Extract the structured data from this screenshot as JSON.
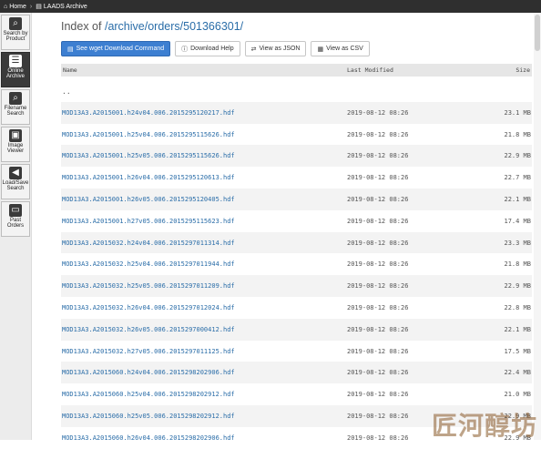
{
  "topbar": {
    "home_label": "Home",
    "archive_label": "LAADS Archive"
  },
  "sidebar": {
    "items": [
      {
        "label1": "Search by",
        "label2": "Product",
        "icon": "search-icon",
        "glyph": "🔍"
      },
      {
        "label1": "Online",
        "label2": "Archive",
        "icon": "list-icon",
        "glyph": "☰"
      },
      {
        "label1": "Filename",
        "label2": "Search",
        "icon": "magnifier-icon",
        "glyph": "🔍"
      },
      {
        "label1": "Image",
        "label2": "Viewer",
        "icon": "image-icon",
        "glyph": "▣"
      },
      {
        "label1": "Load/Save",
        "label2": "Search",
        "icon": "back-arrow-icon",
        "glyph": "◀"
      },
      {
        "label1": "Past",
        "label2": "Orders",
        "icon": "folder-icon",
        "glyph": "▭"
      }
    ]
  },
  "page": {
    "title_prefix": "Index of",
    "title_path": "/archive/orders/501366301/"
  },
  "toolbar": {
    "wget_label": "See wget Download Command",
    "help_label": "Download Help",
    "json_label": "View as JSON",
    "csv_label": "View as CSV"
  },
  "table": {
    "headers": {
      "name": "Name",
      "modified": "Last Modified",
      "size": "Size"
    },
    "parent_label": "..",
    "rows": [
      {
        "name": "MOD13A3.A2015001.h24v04.006.2015295120217.hdf",
        "modified": "2019-08-12 08:26",
        "size": "23.1 MB"
      },
      {
        "name": "MOD13A3.A2015001.h25v04.006.2015295115626.hdf",
        "modified": "2019-08-12 08:26",
        "size": "21.8 MB"
      },
      {
        "name": "MOD13A3.A2015001.h25v05.006.2015295115626.hdf",
        "modified": "2019-08-12 08:26",
        "size": "22.9 MB"
      },
      {
        "name": "MOD13A3.A2015001.h26v04.006.2015295120613.hdf",
        "modified": "2019-08-12 08:26",
        "size": "22.7 MB"
      },
      {
        "name": "MOD13A3.A2015001.h26v05.006.2015295120405.hdf",
        "modified": "2019-08-12 08:26",
        "size": "22.1 MB"
      },
      {
        "name": "MOD13A3.A2015001.h27v05.006.2015295115623.hdf",
        "modified": "2019-08-12 08:26",
        "size": "17.4 MB"
      },
      {
        "name": "MOD13A3.A2015032.h24v04.006.2015297011314.hdf",
        "modified": "2019-08-12 08:26",
        "size": "23.3 MB"
      },
      {
        "name": "MOD13A3.A2015032.h25v04.006.2015297011944.hdf",
        "modified": "2019-08-12 08:26",
        "size": "21.8 MB"
      },
      {
        "name": "MOD13A3.A2015032.h25v05.006.2015297011209.hdf",
        "modified": "2019-08-12 08:26",
        "size": "22.9 MB"
      },
      {
        "name": "MOD13A3.A2015032.h26v04.006.2015297012024.hdf",
        "modified": "2019-08-12 08:26",
        "size": "22.8 MB"
      },
      {
        "name": "MOD13A3.A2015032.h26v05.006.2015297000412.hdf",
        "modified": "2019-08-12 08:26",
        "size": "22.1 MB"
      },
      {
        "name": "MOD13A3.A2015032.h27v05.006.2015297011125.hdf",
        "modified": "2019-08-12 08:26",
        "size": "17.5 MB"
      },
      {
        "name": "MOD13A3.A2015060.h24v04.006.2015298202906.hdf",
        "modified": "2019-08-12 08:26",
        "size": "22.4 MB"
      },
      {
        "name": "MOD13A3.A2015060.h25v04.006.2015298202912.hdf",
        "modified": "2019-08-12 08:26",
        "size": "21.0 MB"
      },
      {
        "name": "MOD13A3.A2015060.h25v05.006.2015298202912.hdf",
        "modified": "2019-08-12 08:26",
        "size": "22.9 MB"
      },
      {
        "name": "MOD13A3.A2015060.h26v04.006.2015298202906.hdf",
        "modified": "2019-08-12 08:26",
        "size": "22.9 MB"
      }
    ]
  },
  "watermark": {
    "text": "匠河醇坊"
  },
  "colors": {
    "link": "#2a6da8",
    "primary_button": "#3d7fd1",
    "topbar": "#2f2f2f"
  }
}
